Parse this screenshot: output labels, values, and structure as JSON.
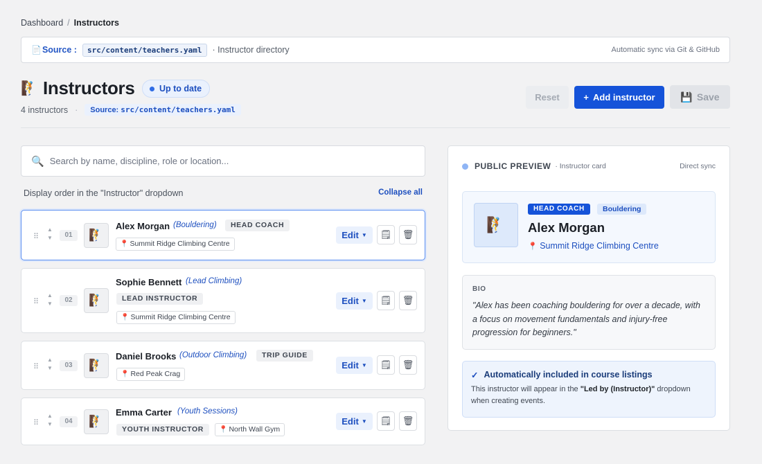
{
  "breadcrumb": {
    "parent": "Dashboard",
    "separator": "/",
    "current": "Instructors"
  },
  "source_bar": {
    "label": "Source :",
    "path": "src/content/teachers.yaml",
    "description": "· Instructor directory",
    "sync_text": "Automatic sync via Git & GitHub"
  },
  "header": {
    "title": "Instructors",
    "status": "Up to date",
    "count": "4 instructors",
    "source_chip_label": "Source:",
    "source_chip_path": "src/content/teachers.yaml"
  },
  "actions": {
    "reset": "Reset",
    "add": "Add instructor",
    "save": "Save"
  },
  "search": {
    "placeholder": "Search by name, discipline, role or location..."
  },
  "list": {
    "order_label": "Display order in the \"Instructor\" dropdown",
    "collapse_all": "Collapse all",
    "edit_label": "Edit",
    "items": [
      {
        "number": "01",
        "name": "Alex Morgan",
        "discipline": "(Bouldering)",
        "role": "HEAD COACH",
        "location": "Summit Ridge Climbing Centre"
      },
      {
        "number": "02",
        "name": "Sophie Bennett",
        "discipline": "(Lead Climbing)",
        "role": "LEAD INSTRUCTOR",
        "location": "Summit Ridge Climbing Centre"
      },
      {
        "number": "03",
        "name": "Daniel Brooks",
        "discipline": "(Outdoor Climbing)",
        "role": "TRIP GUIDE",
        "location": "Red Peak Crag"
      },
      {
        "number": "04",
        "name": "Emma Carter",
        "discipline": "(Youth Sessions)",
        "role": "YOUTH INSTRUCTOR",
        "location": "North Wall Gym"
      }
    ]
  },
  "preview": {
    "title": "PUBLIC PREVIEW",
    "subtitle": "· Instructor card",
    "sync": "Direct sync",
    "role": "HEAD COACH",
    "discipline": "Bouldering",
    "name": "Alex Morgan",
    "location": "Summit Ridge Climbing Centre",
    "bio_label": "BIO",
    "bio": "\"Alex has been coaching bouldering for over a decade, with a focus on movement fundamentals and injury-free progression for beginners.\"",
    "note_title": "Automatically included in course listings",
    "note_body_prefix": "This instructor will appear in the",
    "note_body_bold": "\"Led by (Instructor)\"",
    "note_body_suffix": "dropdown when creating events."
  },
  "colors": {
    "accent": "#1553d9",
    "accent_light": "#eaf1fd",
    "location_pin": "#d6333a"
  },
  "icons": {
    "document": "document-icon",
    "climber": "climber-icon",
    "search": "magnifier-icon",
    "pin": "pin-icon",
    "notes": "notepad-icon",
    "delete": "trash-icon",
    "save": "floppy-disk-icon",
    "check": "check-icon"
  }
}
